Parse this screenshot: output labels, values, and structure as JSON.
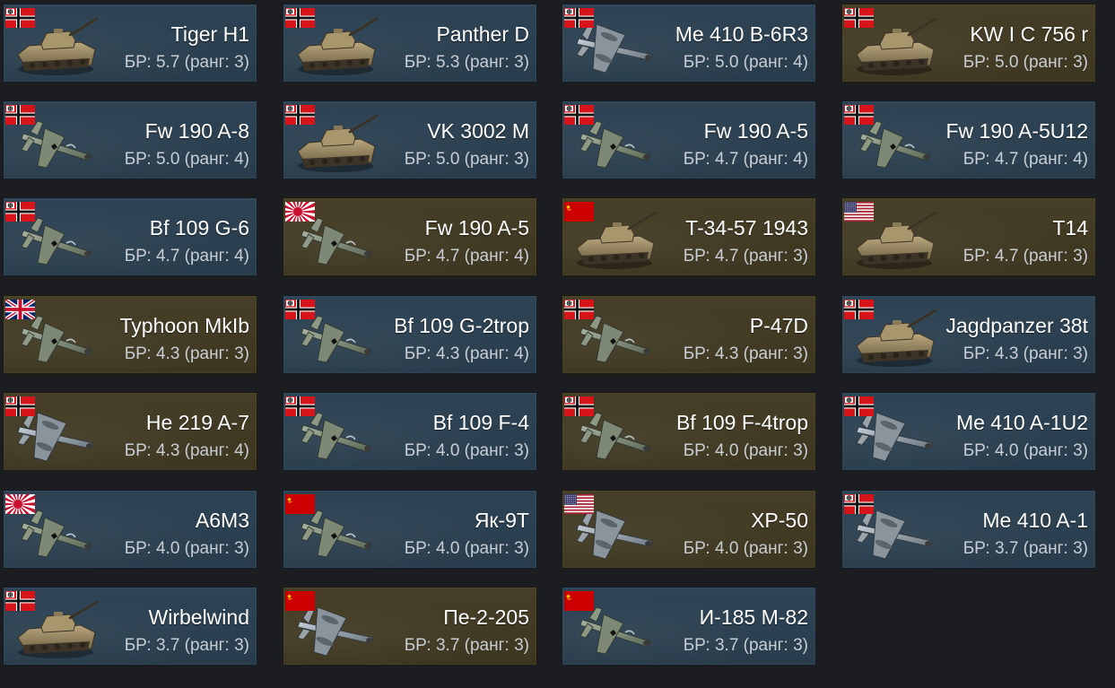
{
  "vehicles": [
    {
      "name": "Tiger H1",
      "br": "БР: 5.7 (ранг: 3)",
      "nation": "germany",
      "type": "tank",
      "tint": "blue"
    },
    {
      "name": "Panther D",
      "br": "БР: 5.3 (ранг: 3)",
      "nation": "germany",
      "type": "tank",
      "tint": "blue"
    },
    {
      "name": "Me 410 B-6R3",
      "br": "БР: 5.0 (ранг: 4)",
      "nation": "germany",
      "type": "twin-plane",
      "tint": "blue"
    },
    {
      "name": "KW I C 756 r",
      "br": "БР: 5.0 (ранг: 3)",
      "nation": "germany",
      "type": "tank",
      "tint": "gold"
    },
    {
      "name": "Fw 190 A-8",
      "br": "БР: 5.0 (ранг: 4)",
      "nation": "germany",
      "type": "plane",
      "tint": "blue"
    },
    {
      "name": "VK 3002 M",
      "br": "БР: 5.0 (ранг: 3)",
      "nation": "germany",
      "type": "tank",
      "tint": "blue"
    },
    {
      "name": "Fw 190 A-5",
      "br": "БР: 4.7 (ранг: 4)",
      "nation": "germany",
      "type": "plane",
      "tint": "blue"
    },
    {
      "name": "Fw 190 A-5U12",
      "br": "БР: 4.7 (ранг: 4)",
      "nation": "germany",
      "type": "plane",
      "tint": "blue"
    },
    {
      "name": "Bf 109 G-6",
      "br": "БР: 4.7 (ранг: 4)",
      "nation": "germany",
      "type": "plane",
      "tint": "blue"
    },
    {
      "name": "Fw 190 A-5",
      "br": "БР: 4.7 (ранг: 4)",
      "nation": "japan",
      "type": "plane",
      "tint": "gold"
    },
    {
      "name": "T-34-57 1943",
      "br": "БР: 4.7 (ранг: 3)",
      "nation": "ussr",
      "type": "tank",
      "tint": "gold"
    },
    {
      "name": "T14",
      "br": "БР: 4.7 (ранг: 3)",
      "nation": "usa",
      "type": "tank",
      "tint": "gold"
    },
    {
      "name": "Typhoon MkIb",
      "br": "БР: 4.3 (ранг: 3)",
      "nation": "uk",
      "type": "plane",
      "tint": "gold"
    },
    {
      "name": "Bf 109 G-2trop",
      "br": "БР: 4.3 (ранг: 4)",
      "nation": "germany",
      "type": "plane",
      "tint": "blue"
    },
    {
      "name": "P-47D",
      "br": "БР: 4.3 (ранг: 3)",
      "nation": "germany",
      "type": "plane",
      "tint": "gold"
    },
    {
      "name": "Jagdpanzer 38t",
      "br": "БР: 4.3 (ранг: 3)",
      "nation": "germany",
      "type": "tank",
      "tint": "blue"
    },
    {
      "name": "He 219 A-7",
      "br": "БР: 4.3 (ранг: 4)",
      "nation": "germany",
      "type": "twin-plane",
      "tint": "gold"
    },
    {
      "name": "Bf 109 F-4",
      "br": "БР: 4.0 (ранг: 3)",
      "nation": "germany",
      "type": "plane",
      "tint": "blue"
    },
    {
      "name": "Bf 109 F-4trop",
      "br": "БР: 4.0 (ранг: 3)",
      "nation": "germany",
      "type": "plane",
      "tint": "gold"
    },
    {
      "name": "Me 410 A-1U2",
      "br": "БР: 4.0 (ранг: 3)",
      "nation": "germany",
      "type": "twin-plane",
      "tint": "blue"
    },
    {
      "name": "A6M3",
      "br": "БР: 4.0 (ранг: 3)",
      "nation": "japan",
      "type": "plane",
      "tint": "blue"
    },
    {
      "name": "Як-9Т",
      "br": "БР: 4.0 (ранг: 3)",
      "nation": "ussr",
      "type": "plane",
      "tint": "blue"
    },
    {
      "name": "XP-50",
      "br": "БР: 4.0 (ранг: 3)",
      "nation": "usa",
      "type": "twin-plane",
      "tint": "gold"
    },
    {
      "name": "Me 410 A-1",
      "br": "БР: 3.7 (ранг: 3)",
      "nation": "germany",
      "type": "twin-plane",
      "tint": "blue"
    },
    {
      "name": "Wirbelwind",
      "br": "БР: 3.7 (ранг: 3)",
      "nation": "germany",
      "type": "tank",
      "tint": "blue"
    },
    {
      "name": "Пе-2-205",
      "br": "БР: 3.7 (ранг: 3)",
      "nation": "ussr",
      "type": "twin-plane",
      "tint": "gold"
    },
    {
      "name": "И-185 М-82",
      "br": "БР: 3.7 (ранг: 3)",
      "nation": "ussr",
      "type": "plane",
      "tint": "blue"
    }
  ]
}
